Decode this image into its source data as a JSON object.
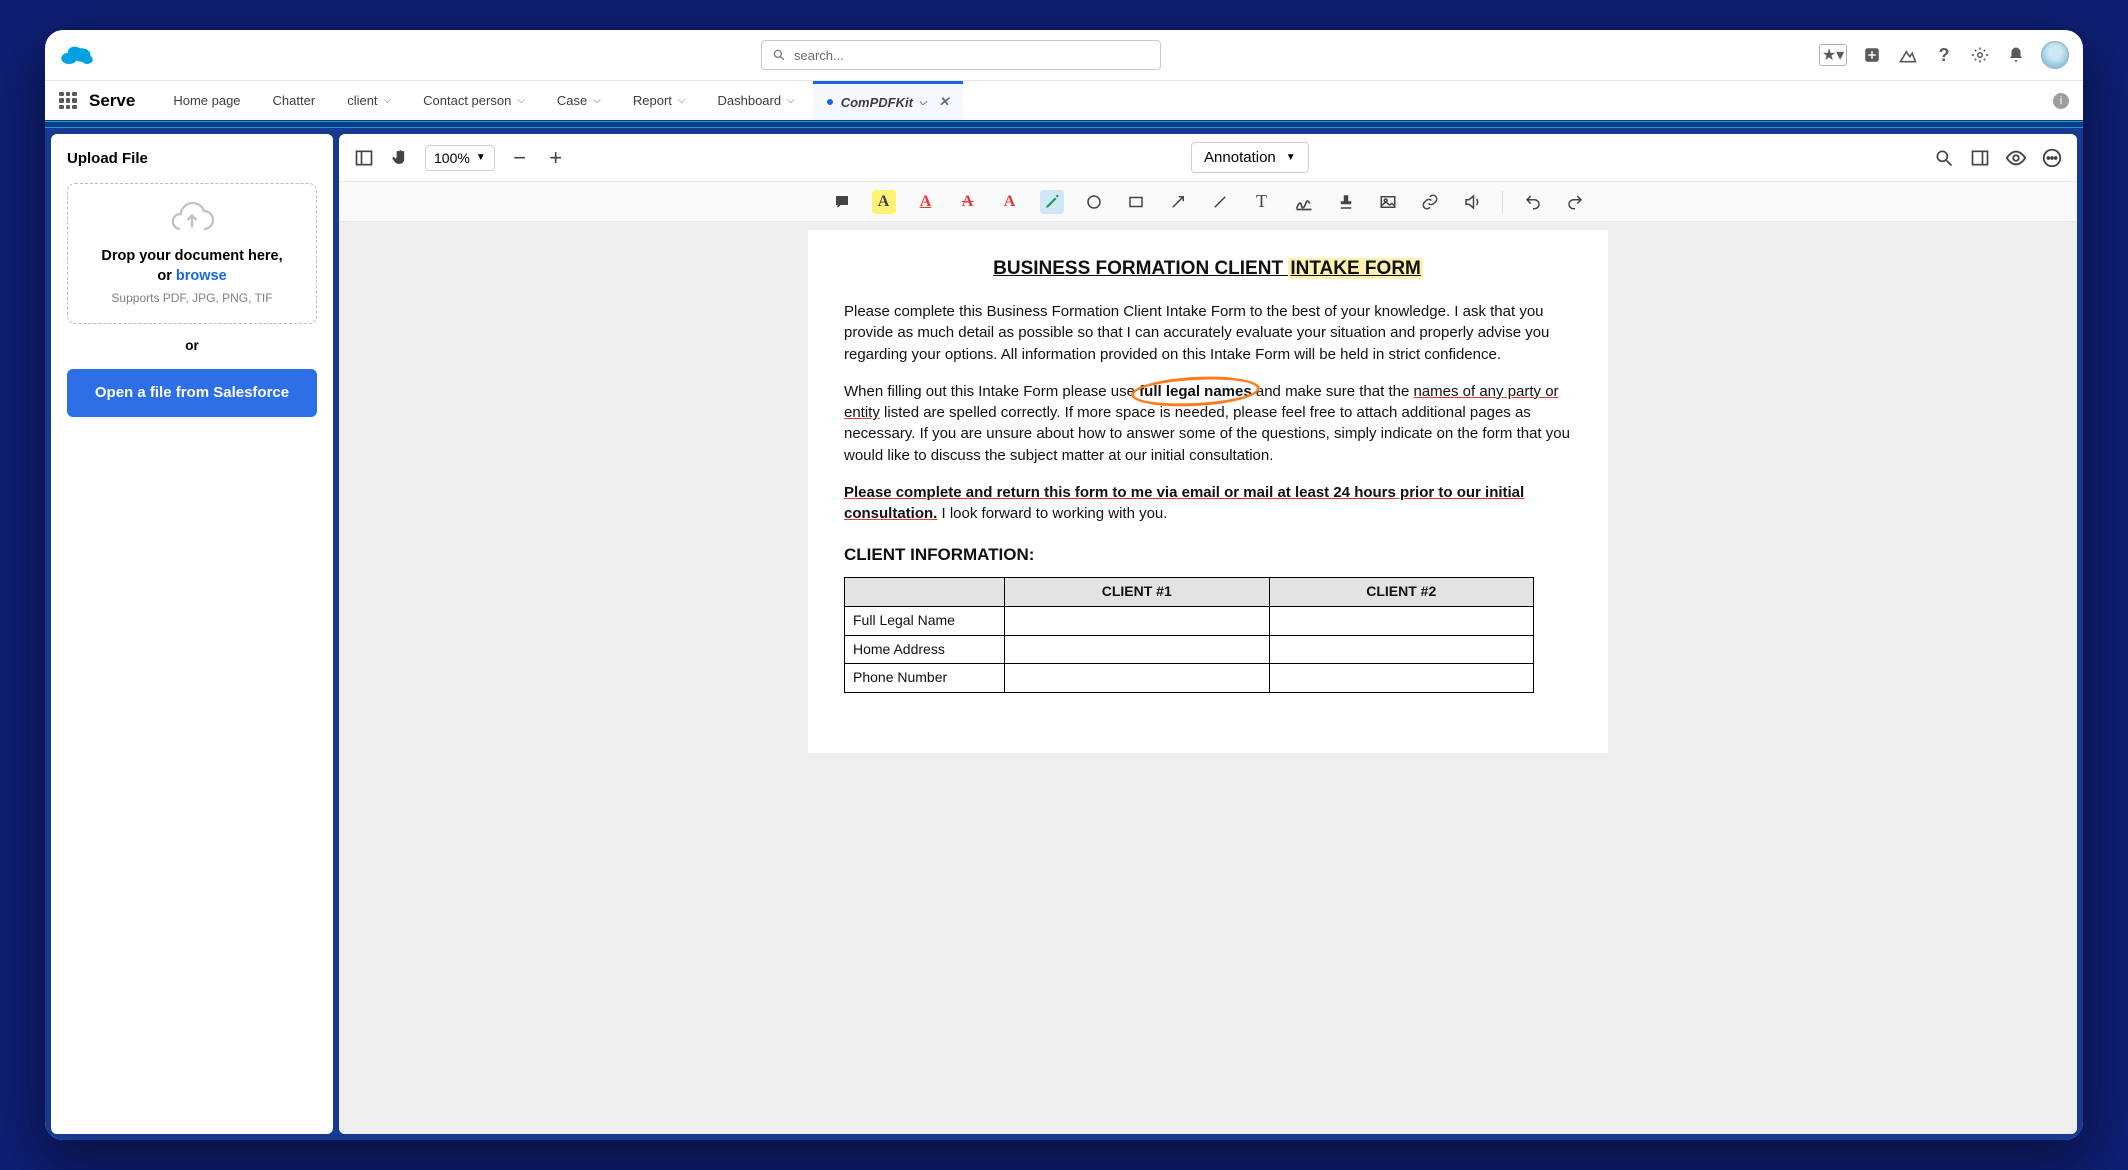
{
  "topbar": {
    "search_placeholder": "search...",
    "app_name": "Serve",
    "nav": [
      {
        "label": "Home page",
        "dropdown": false
      },
      {
        "label": "Chatter",
        "dropdown": false
      },
      {
        "label": "client",
        "dropdown": true
      },
      {
        "label": "Contact person",
        "dropdown": true
      },
      {
        "label": "Case",
        "dropdown": true
      },
      {
        "label": "Report",
        "dropdown": true
      },
      {
        "label": "Dashboard",
        "dropdown": true
      }
    ],
    "active_tab": {
      "label": "ComPDFKit",
      "unsaved": true
    }
  },
  "sidebar": {
    "title": "Upload File",
    "drop_main_line1": "Drop your document here,",
    "drop_main_line2_prefix": "or ",
    "browse": "browse",
    "supports": "Supports PDF, JPG, PNG, TIF",
    "or": "or",
    "open_button": "Open a file from Salesforce"
  },
  "viewer": {
    "zoom": "100%",
    "mode": "Annotation"
  },
  "doc": {
    "title_a": "BUSINESS FORMATION CLIENT ",
    "title_b": "INTAKE FORM",
    "p1": "Please complete this Business Formation Client Intake Form to the best of your knowledge. I ask that you provide as much detail as possible so that I can accurately evaluate your situation and properly advise you regarding your options. All information provided on this Intake Form will be held in strict confidence.",
    "p2_a": "When filling out this Intake Form please use ",
    "p2_circled": "full legal names",
    "p2_b": " and make sure that the ",
    "p2_ul": "names of any party or entity",
    "p2_c": " listed are spelled correctly. If more space is needed, please feel free to attach additional pages as necessary. If you are unsure about how to answer some of the questions, simply indicate on the form that you would like to discuss the subject matter at our initial consultation.",
    "p3_bold_a": "Please complete and return this form to me via email or mail at least ",
    "p3_bold_ul": "24 hours prior to our initial consultation.",
    "p3_tail": " I look forward to working with you.",
    "section": "CLIENT INFORMATION:",
    "table": {
      "headers": [
        "",
        "CLIENT #1",
        "CLIENT #2"
      ],
      "rows": [
        "Full Legal Name",
        "Home Address",
        "Phone Number"
      ]
    }
  }
}
